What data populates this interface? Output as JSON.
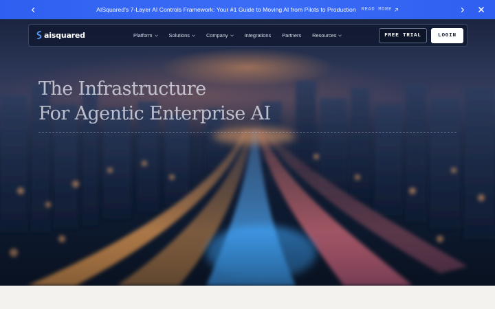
{
  "announcement": {
    "message": "AISquared's 7-Layer AI Controls Framework: Your #1 Guide to Moving AI from Pilots to Production",
    "read_more": "READ MORE",
    "prev_icon": "chevron-left-icon",
    "next_icon": "chevron-right-icon",
    "close_icon": "close-icon",
    "background": "#3b6cf6"
  },
  "nav": {
    "logo_text": "aisquared",
    "items": [
      {
        "label": "Platform",
        "has_dropdown": true
      },
      {
        "label": "Solutions",
        "has_dropdown": true
      },
      {
        "label": "Company",
        "has_dropdown": true
      },
      {
        "label": "Integrations",
        "has_dropdown": false
      },
      {
        "label": "Partners",
        "has_dropdown": false
      },
      {
        "label": "Resources",
        "has_dropdown": true
      }
    ],
    "free_trial": "FREE TRIAL",
    "login": "LOGIN"
  },
  "hero": {
    "headline_line1": "The Infrastructure",
    "headline_line2": "For Agentic Enterprise AI"
  },
  "colors": {
    "accent": "#3b6cf6",
    "nav_bg": "#0e162c",
    "page_bg": "#f3f2ef"
  }
}
